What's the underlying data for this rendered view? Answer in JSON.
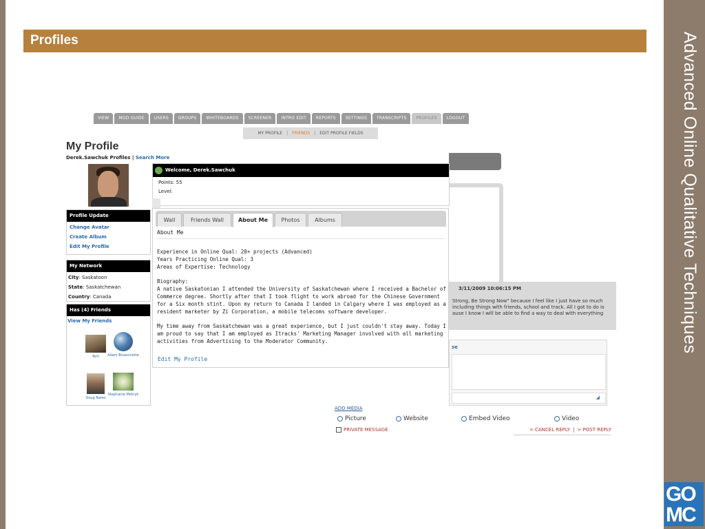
{
  "slide": {
    "header": "Profiles",
    "vertical_title": "Advanced Online Qualitative Techniques",
    "logo_line1": "GO",
    "logo_line2": "MC"
  },
  "nav": {
    "tabs": [
      "VIEW",
      "MOD GUIDE",
      "USERS",
      "GROUPS",
      "WHITEBOARDS",
      "SCREENER",
      "INTRO EDIT",
      "REPORTS",
      "SETTINGS",
      "TRANSCRIPTS",
      "PROFILES",
      "LOGOUT"
    ],
    "active_tab": "PROFILES",
    "subnav": [
      "MY PROFILE",
      "FRIENDS",
      "EDIT PROFILE FIELDS"
    ],
    "subnav_active": "FRIENDS"
  },
  "profile": {
    "title": "My Profile",
    "owner_profiles": "Derek.Sawchuk Profiles",
    "separator": "|",
    "search_more": "Search More"
  },
  "profile_update": {
    "header": "Profile Update",
    "links": [
      "Change Avatar",
      "Create Album",
      "Edit My Profile"
    ]
  },
  "network": {
    "header": "My Network",
    "city_label": "City",
    "city": "Saskatoon",
    "state_label": "State",
    "state": "Saskatchewan",
    "country_label": "Country",
    "country": "Canada"
  },
  "friends": {
    "header": "Has (4) Friends",
    "view_link": "View My Friends",
    "list": [
      "Terri",
      "Adam Bissonnette",
      "Doug Bates",
      "Stephanie Melnyk"
    ]
  },
  "welcome": {
    "header": "Welcome, Derek.Sawchuk",
    "points_label": "Points",
    "points": "55",
    "level_label": "Level"
  },
  "about": {
    "tabs": [
      "Wall",
      "Friends Wall",
      "About Me",
      "Photos",
      "Albums"
    ],
    "active_tab": "About Me",
    "section_title": "About Me",
    "experience": "Experience in Online Qual: 20+ projects (Advanced)",
    "years": "Years Practicing Online Qual: 3",
    "expertise": "Areas of Expertise: Technology",
    "bio_label": "Biography:",
    "bio1": "A native Saskatonian I attended the University of Saskatchewan where I received a Bachelor of Commerce degree.  Shortly after that I took flight to work abroad for the Chinese Government for a Six month stint.  Upon my return to Canada I landed in Calgary where I was employed as a resident marketer by Zi Corporation, a mobile telecoms software developer.",
    "bio2": "My time away from Saskatchewan was a great experience, but I just couldn't stay away. Today I am proud to say that I am employed as Itracks' Marketing Manager involved with all marketing activities from Advertising to the Moderator Community.",
    "edit_link": "Edit My Profile"
  },
  "background": {
    "comment_date": "3/11/2009 10:06:15 PM",
    "comment_text": "Strong, Be Strong Now\" because I feel like I just have so much including things with friends, school and track. All I got to do is ause I know I will be able to find a way to deal with everything",
    "reply_label": "se",
    "add_media": "ADD MEDIA",
    "media_options": [
      "Picture",
      "Website",
      "Embed Video",
      "Video"
    ],
    "private_message": "PRIVATE MESSAGE",
    "cancel_reply": "> CANCEL REPLY",
    "post_reply": "> POST REPLY",
    "separator": "|"
  },
  "colors": {
    "header_bar": "#b7803d",
    "side_panel": "#8d7b6b",
    "link": "#2a6aa8",
    "logo": "#2a73b8"
  }
}
